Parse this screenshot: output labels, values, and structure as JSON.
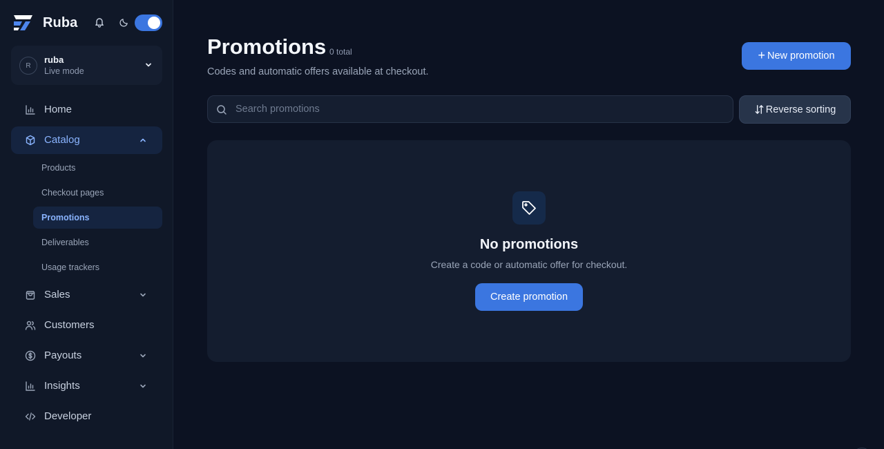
{
  "sidebar": {
    "brand": "Ruba",
    "account": {
      "initial": "R",
      "name": "ruba",
      "mode": "Live mode"
    },
    "theme_toggle_on": true,
    "nav": [
      {
        "label": "Home",
        "icon": "bar-chart-icon"
      },
      {
        "label": "Catalog",
        "icon": "box-icon",
        "expanded": true
      },
      {
        "label": "Sales",
        "icon": "shopping-bag-icon"
      },
      {
        "label": "Customers",
        "icon": "users-icon"
      },
      {
        "label": "Payouts",
        "icon": "dollar-circle-icon"
      },
      {
        "label": "Insights",
        "icon": "bar-chart-icon"
      },
      {
        "label": "Developer",
        "icon": "code-icon"
      }
    ],
    "catalog_sub": [
      "Products",
      "Checkout pages",
      "Promotions",
      "Deliverables",
      "Usage trackers"
    ]
  },
  "main": {
    "title": "Promotions",
    "total": "0 total",
    "subtitle": "Codes and automatic offers available at checkout.",
    "new_button": "New promotion",
    "search_placeholder": "Search promotions",
    "sort_button": "Reverse sorting",
    "empty": {
      "title": "No promotions",
      "text": "Create a code or automatic offer for checkout.",
      "button": "Create promotion"
    }
  },
  "colors": {
    "accent": "#3b76e0",
    "background": "#0c1222",
    "sidebar": "#101828",
    "active_text": "#8ab4ff"
  }
}
